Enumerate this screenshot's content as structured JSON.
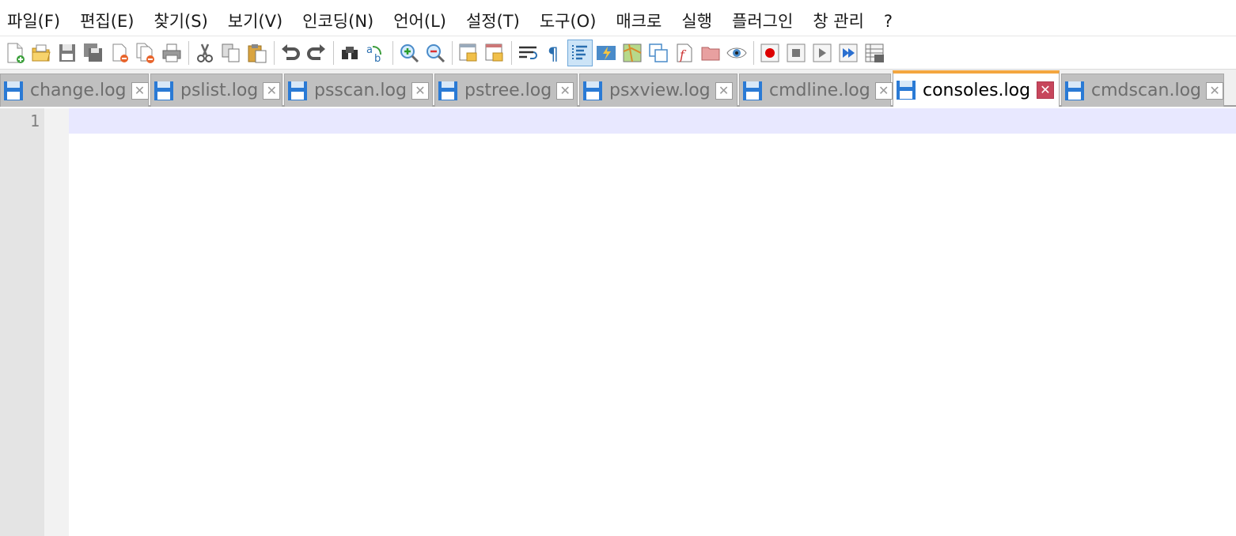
{
  "menu": [
    "파일(F)",
    "편집(E)",
    "찾기(S)",
    "보기(V)",
    "인코딩(N)",
    "언어(L)",
    "설정(T)",
    "도구(O)",
    "매크로",
    "실행",
    "플러그인",
    "창 관리",
    "?"
  ],
  "toolbar": {
    "icons": [
      "new-file-icon",
      "open-file-icon",
      "save-icon",
      "save-all-icon",
      "close-icon",
      "close-all-icon",
      "print-icon",
      "cut-icon",
      "copy-icon",
      "paste-icon",
      "undo-icon",
      "redo-icon",
      "find-icon",
      "replace-icon",
      "zoom-in-icon",
      "zoom-out-icon",
      "sync-vertical-icon",
      "sync-horizontal-icon",
      "word-wrap-icon",
      "show-all-chars-icon",
      "indent-guide-icon",
      "udl-icon",
      "document-map-icon",
      "document-list-icon",
      "function-list-icon",
      "folder-workspace-icon",
      "monitoring-icon",
      "record-macro-icon",
      "stop-macro-icon",
      "play-macro-icon",
      "run-macro-multiple-icon",
      "save-macro-icon"
    ],
    "active": "indent-guide-icon"
  },
  "tabs": [
    {
      "label": "change.log",
      "active": false
    },
    {
      "label": "pslist.log",
      "active": false
    },
    {
      "label": "psscan.log",
      "active": false
    },
    {
      "label": "pstree.log",
      "active": false
    },
    {
      "label": "psxview.log",
      "active": false
    },
    {
      "label": "cmdline.log",
      "active": false
    },
    {
      "label": "consoles.log",
      "active": true
    },
    {
      "label": "cmdscan.log",
      "active": false
    }
  ],
  "tab_close_glyph": "✕",
  "editor": {
    "line_numbers": [
      "1"
    ]
  },
  "colors": {
    "active_tab_accent": "#f4a63f",
    "current_line": "#e8e8ff",
    "close_active": "#c7465c",
    "save_icon": "#2a7ad5"
  }
}
